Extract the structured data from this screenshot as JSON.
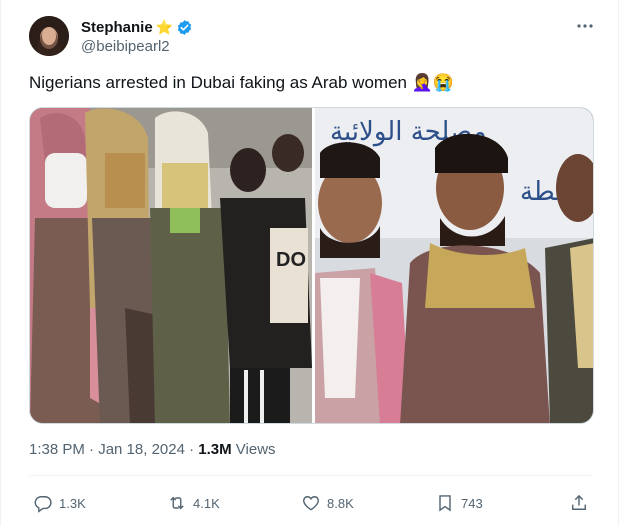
{
  "tweet": {
    "author": {
      "display_name": "Stephanie",
      "emoji": "⭐",
      "handle": "@beibipearl2",
      "verified": true
    },
    "text": "Nigerians arrested in Dubai faking as Arab women 🤦‍♀️😭",
    "media": {
      "banner_text_line1": "مصلحة الولائية",
      "banner_text_line2": "عطة"
    },
    "timestamp": "1:38 PM · Jan 18, 2024",
    "separator": " · ",
    "views_count": "1.3M",
    "views_label": " Views",
    "actions": {
      "replies": "1.3K",
      "reposts": "4.1K",
      "likes": "8.8K",
      "bookmarks": "743"
    }
  },
  "colors": {
    "verified_badge": "#1d9bf0",
    "secondary_text": "#536471",
    "primary_text": "#0f1419",
    "border": "#cfd9de"
  },
  "icons": [
    "more-icon",
    "verified-badge-icon",
    "reply-icon",
    "repost-icon",
    "like-icon",
    "bookmark-icon",
    "share-icon"
  ]
}
